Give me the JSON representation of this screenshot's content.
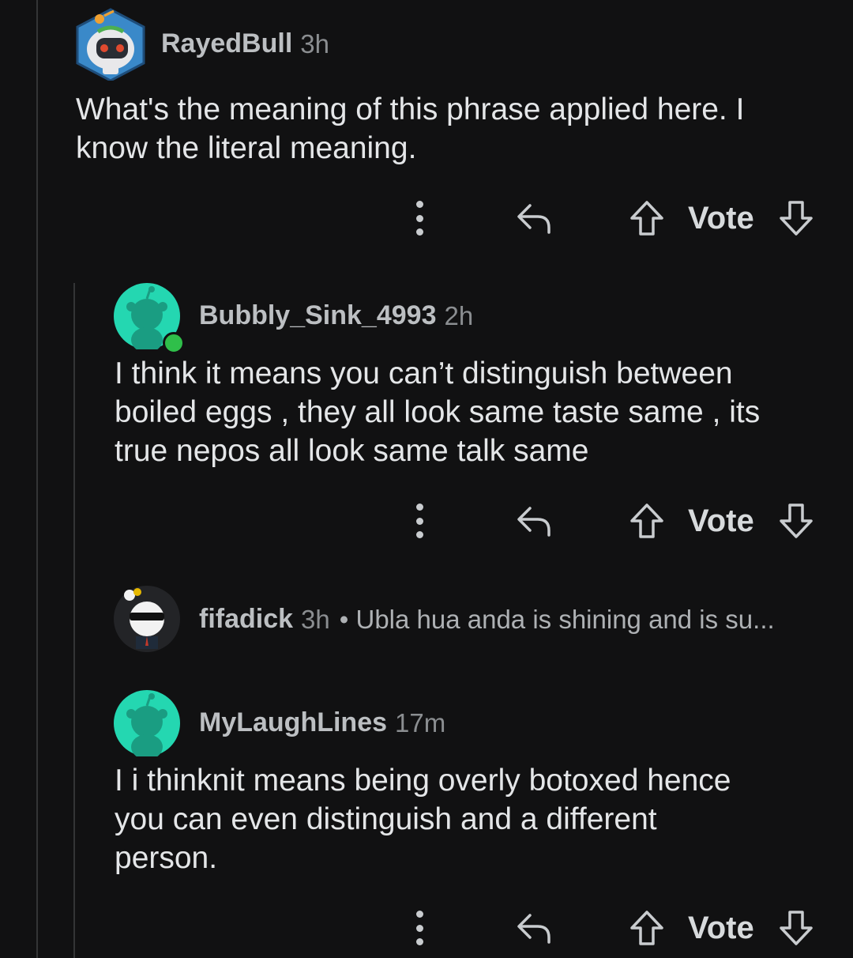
{
  "comments": [
    {
      "username": "RayedBull",
      "time": "3h",
      "body_lines": [
        "What's the meaning of this phrase applied here. I",
        "know the literal meaning."
      ],
      "avatar": "robot-avatar-icon",
      "vote_label": "Vote"
    },
    {
      "username": "Bubbly_Sink_4993",
      "time": "2h",
      "body_lines": [
        "I think it means you can’t distinguish between",
        "boiled eggs , they all look same taste same , its",
        "true nepos all look same talk same"
      ],
      "avatar": "snoo-avatar-icon",
      "online_indicator": true,
      "vote_label": "Vote"
    },
    {
      "username": "fifadick",
      "time": "3h",
      "collapsed": true,
      "preview": "• Ubla hua anda is shining and is su...",
      "avatar": "sunglasses-snoo-avatar-icon"
    },
    {
      "username": "MyLaughLines",
      "time": "17m",
      "body_lines": [
        "I i thinknit means being overly botoxed hence",
        "you can even distinguish and a different",
        "person."
      ],
      "avatar": "snoo-avatar-icon",
      "vote_label": "Vote"
    }
  ],
  "colors": {
    "background": "#111112",
    "thread_line": "#343536",
    "snoo_teal": "#24d7b1",
    "online_green": "#2fbf4a"
  },
  "icons": [
    "more-options-icon",
    "reply-icon",
    "upvote-icon",
    "downvote-icon"
  ]
}
